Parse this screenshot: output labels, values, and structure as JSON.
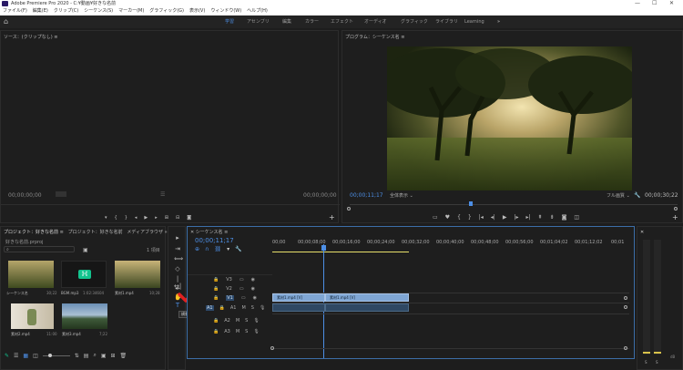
{
  "titlebar": {
    "title": "Adobe Premiere Pro 2020 - C:¥動画¥好きな名前",
    "min": "—",
    "max": "☐",
    "close": "✕"
  },
  "menu": [
    "ファイル(F)",
    "編集(E)",
    "クリップ(C)",
    "シーケンス(S)",
    "マーカー(M)",
    "グラフィック(G)",
    "表示(V)",
    "ウィンドウ(W)",
    "ヘルプ(H)"
  ],
  "workspaces": [
    "学習",
    "アセンブリ",
    "編集",
    "カラー",
    "エフェクト",
    "オーディオ",
    "グラフィック",
    "ライブラリ",
    "Learning"
  ],
  "source": {
    "title": "ソース：(クリップなし)",
    "tc_left": "00;00;00;00",
    "tc_right": "00;00;00;00"
  },
  "program": {
    "title": "プログラム：シーケンス名",
    "tc": "00;00;11;17",
    "fit": "全体表示",
    "quality": "フル画質",
    "duration": "00;00;30;22"
  },
  "project": {
    "tab1": "プロジェクト：好きな名前",
    "tab2": "プロジェクト：好きな名前",
    "tab3": "メディアブラウザ",
    "file": "好きな名前.prproj",
    "count": "1 項目",
    "items": [
      {
        "name": "シーケンス名",
        "dur": "30;22"
      },
      {
        "name": "BGM.mp3",
        "dur": "1:02:34604"
      },
      {
        "name": "素材1.mp4",
        "dur": "10;28"
      },
      {
        "name": "素材2.mp4",
        "dur": "11:00"
      },
      {
        "name": "素材3.mp4",
        "dur": "7;22"
      }
    ]
  },
  "timeline": {
    "title": "シーケンス名",
    "tc": "00;00;11;17",
    "ruler": [
      "00;00",
      "00;00;08;00",
      "00;00;16;00",
      "00;00;24;00",
      "00;00;32;00",
      "00;00;40;00",
      "00;00;48;00",
      "00;00;56;00",
      "00;01;04;02",
      "00;01;12;02",
      "00;01"
    ],
    "vtracks": [
      "V3",
      "V2",
      "V1"
    ],
    "atracks": [
      "A1",
      "A2",
      "A3"
    ],
    "clip1": "素材1.mp4 [V]",
    "clip2": "素材1.mp4 [V]"
  },
  "tooltip": "横書き文字ツール (T)",
  "meter": {
    "db": "dB",
    "s1": "S",
    "s2": "S"
  },
  "colors": {
    "accent": "#4d8fe6",
    "bg": "#1d1d1d",
    "clip": "#7fa6d4",
    "check": "#e02020"
  }
}
